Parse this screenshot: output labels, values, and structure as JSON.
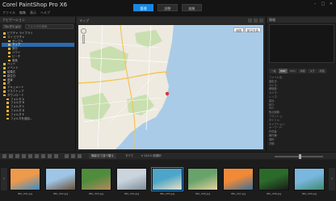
{
  "app": {
    "title": "Corel PaintShop Pro X6"
  },
  "menu": [
    "ファイル",
    "編集",
    "表示",
    "ヘルプ"
  ],
  "tabs": [
    {
      "label": "管理"
    },
    {
      "label": "調整"
    },
    {
      "label": "編集"
    }
  ],
  "window_controls": [
    "–",
    "□",
    "✕"
  ],
  "left_panel": {
    "title": "ナビゲーション",
    "tool_labels": [
      "コレクション",
      "コンピュータ"
    ],
    "search_placeholder": "フォルダの検索",
    "tree": [
      {
        "label": "ピクチャ ライブラリ",
        "selected": false
      },
      {
        "label": "マイ ピクチャ",
        "selected": false
      },
      {
        "label": "サンプル",
        "selected": false
      },
      {
        "label": "マップ",
        "selected": true
      },
      {
        "label": "旅行",
        "selected": false
      },
      {
        "label": "ハワイ",
        "selected": false
      },
      {
        "label": "ビーチ",
        "selected": false
      },
      {
        "label": "家族",
        "selected": false
      },
      {
        "label": "ペット",
        "selected": false
      },
      {
        "label": "イベント",
        "selected": false
      },
      {
        "label": "結婚式",
        "selected": false
      },
      {
        "label": "誕生日",
        "selected": false
      },
      {
        "label": "風景",
        "selected": false
      },
      {
        "label": "花",
        "selected": false
      },
      {
        "label": "ドキュメント",
        "selected": false
      },
      {
        "label": "デスクトップ",
        "selected": false
      },
      {
        "label": "ダウンロード",
        "selected": false
      },
      {
        "label": "フォルダ A",
        "selected": false
      },
      {
        "label": "フォルダ B",
        "selected": false
      },
      {
        "label": "フォルダ C",
        "selected": false
      },
      {
        "label": "フォルダ D",
        "selected": false
      },
      {
        "label": "フォルダ E",
        "selected": false
      },
      {
        "label": "フォルダを追加...",
        "selected": false
      }
    ]
  },
  "center": {
    "title": "マップ",
    "map_types": [
      "地図",
      "航空写真"
    ]
  },
  "right_panel": {
    "title": "情報",
    "tabs": [
      "一般",
      "EXIF",
      "IPTC",
      "詳細",
      "タグ",
      "評価"
    ],
    "info_rows": [
      {
        "k": "ファイル名:",
        "v": ""
      },
      {
        "k": "撮影日:",
        "v": ""
      },
      {
        "k": "サイズ:",
        "v": ""
      },
      {
        "k": "解像度:",
        "v": ""
      },
      {
        "k": "カメラ:",
        "v": ""
      },
      {
        "k": "レンズ:",
        "v": ""
      },
      {
        "k": "露出:",
        "v": ""
      },
      {
        "k": "絞り:",
        "v": ""
      },
      {
        "k": "ISO:",
        "v": ""
      },
      {
        "k": "焦点距離:",
        "v": ""
      },
      {
        "k": "フラッシュ:",
        "v": ""
      },
      {
        "k": "タイトル:",
        "v": ""
      },
      {
        "k": "キャプション:",
        "v": ""
      },
      {
        "k": "キーワード:",
        "v": ""
      },
      {
        "k": "作成者:",
        "v": ""
      },
      {
        "k": "著作権:",
        "v": ""
      },
      {
        "k": "場所:",
        "v": ""
      },
      {
        "k": "評価:",
        "v": ""
      }
    ]
  },
  "bottom_bar": {
    "sort_label": "撮影日で並べ替え",
    "filter_label": "すべて",
    "count_label": "▾ 10/10 個選択"
  },
  "thumbnails": [
    {
      "label": "IMG_001.jpg",
      "c1": "#ee9a4c",
      "c2": "#3a8bc8"
    },
    {
      "label": "IMG_002.jpg",
      "c1": "#9ec5e6",
      "c2": "#6b4f34"
    },
    {
      "label": "IMG_003.jpg",
      "c1": "#4f8c3c",
      "c2": "#b48a5e"
    },
    {
      "label": "IMG_004.jpg",
      "c1": "#c9d4dd",
      "c2": "#7d8c98"
    },
    {
      "label": "IMG_005.jpg",
      "c1": "#4ba6c9",
      "c2": "#f0e1c2"
    },
    {
      "label": "IMG_006.jpg",
      "c1": "#68a36a",
      "c2": "#e6d2a2"
    },
    {
      "label": "IMG_007.jpg",
      "c1": "#f08a39",
      "c2": "#3b6f9a"
    },
    {
      "label": "IMG_008.jpg",
      "c1": "#2b6b2a",
      "c2": "#1a1a1a"
    },
    {
      "label": "IMG_009.jpg",
      "c1": "#7ab7df",
      "c2": "#3f8a6f"
    }
  ],
  "colors": {
    "accent": "#1a88e0",
    "folder": "#e4b43a",
    "water": "#a9cbe8",
    "land": "#eeeae0",
    "park": "#c9dfb0"
  }
}
